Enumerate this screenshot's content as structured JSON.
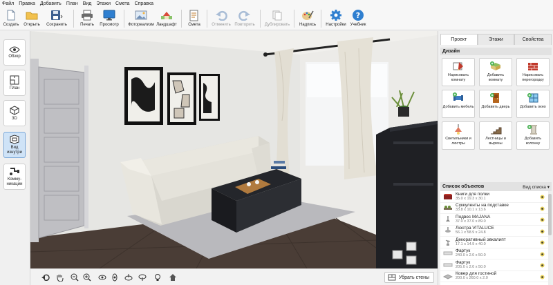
{
  "menu": [
    "Файл",
    "Правка",
    "Добавить",
    "План",
    "Вид",
    "Этажи",
    "Смета",
    "Справка"
  ],
  "toolbar": {
    "create": "Создать",
    "open": "Открыть",
    "save": "Сохранить",
    "print": "Печать",
    "preview": "Просмотр",
    "photorealism": "Фотореализм",
    "landscape": "Ландшафт",
    "estimate": "Смета",
    "undo": "Отменить",
    "redo": "Повторить",
    "duplicate": "Дублировать",
    "label": "Надпись",
    "settings": "Настройки",
    "tutorial": "Учебник"
  },
  "left_sidebar": {
    "overview": "Обзор",
    "plan": "План",
    "view3d": "3D",
    "inside_view": "Вид изнутри",
    "communications": "Комму- никации"
  },
  "bottom_bar": {
    "remove_walls": "Убрать стены"
  },
  "right_panel": {
    "tabs": [
      "Проект",
      "Этажи",
      "Свойства"
    ],
    "active_tab": "Проект",
    "design_title": "Дизайн",
    "design_buttons": [
      {
        "label": "Нарисовать комнату",
        "icon": "draw-room-icon"
      },
      {
        "label": "Добавить комнату",
        "icon": "add-room-icon"
      },
      {
        "label": "Нарисовать перегородку",
        "icon": "draw-partition-icon"
      },
      {
        "label": "Добавить мебель",
        "icon": "add-furniture-icon"
      },
      {
        "label": "Добавить дверь",
        "icon": "add-door-icon"
      },
      {
        "label": "Добавить окно",
        "icon": "add-window-icon"
      },
      {
        "label": "Светильники и люстры",
        "icon": "lamp-icon"
      },
      {
        "label": "Лестницы и вырезы",
        "icon": "stairs-icon"
      },
      {
        "label": "Добавить колонну",
        "icon": "add-column-icon"
      }
    ],
    "objects_title": "Список объектов",
    "view_list": "Вид списка",
    "objects": [
      {
        "name": "Книги для полки",
        "dims": "35.0 x 19.3 x 30.1"
      },
      {
        "name": "Суккуленты на подставке",
        "dims": "33.8 x 10.1 x 13.6"
      },
      {
        "name": "Подвес MAJANA",
        "dims": "37.0 x 37.0 x 89.0"
      },
      {
        "name": "Люстра VITALUCE",
        "dims": "56.1 x 58.9 x 24.8"
      },
      {
        "name": "Декоративный эвкалипт",
        "dims": "17.1 x 14.9 x 40.0"
      },
      {
        "name": "Фартук",
        "dims": "240.0 x 2.0 x 50.0"
      },
      {
        "name": "Фартук",
        "dims": "205.0 x 2.0 x 50.0"
      },
      {
        "name": "Ковер для гостиной",
        "dims": "200.0 x 260.0 x 2.0"
      }
    ]
  },
  "colors": {
    "accent": "#cfe3f7",
    "panel_bg": "#f0f0f0",
    "section_header": "#e2e2e2",
    "sofa": "#e4e2da",
    "table": "#24262b",
    "floor": "#4a3d36",
    "rug": "#b9b9bd"
  }
}
